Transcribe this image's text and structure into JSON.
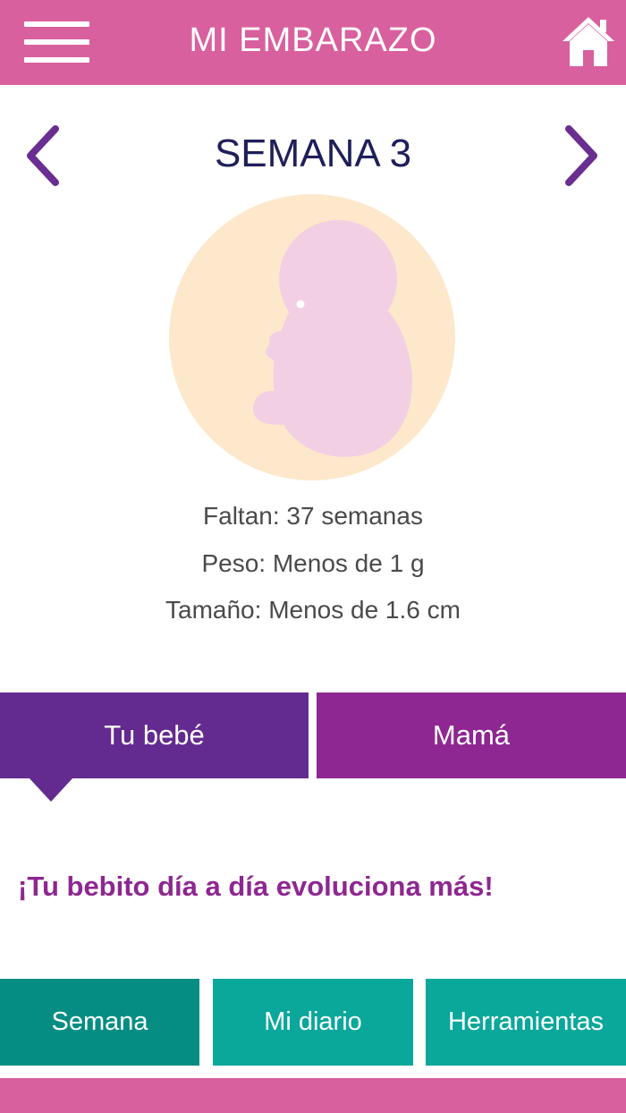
{
  "header": {
    "title": "MI EMBARAZO",
    "menu_icon": "hamburger-menu-icon",
    "home_icon": "home-icon",
    "background_color": "#d9609e"
  },
  "week": {
    "title": "SEMANA 3",
    "prev_icon": "chevron-left-icon",
    "next_icon": "chevron-right-icon",
    "arrow_color": "#6a2d91"
  },
  "illustration": {
    "icon": "fetus-illustration",
    "circle_color": "#fde8cc",
    "figure_color": "#f3cfe4"
  },
  "stats": {
    "remaining": "Faltan: 37 semanas",
    "weight": "Peso: Menos de 1 g",
    "size": "Tamaño: Menos de 1.6 cm"
  },
  "tabs": {
    "baby": "Tu bebé",
    "mom": "Mamá",
    "active": "baby"
  },
  "content": {
    "headline": "¡Tu bebito día a día evoluciona más!"
  },
  "bottom_nav": {
    "semana": "Semana",
    "diario": "Mi diario",
    "herramientas": "Herramientas",
    "active": "semana"
  },
  "colors": {
    "pink": "#d9609e",
    "purple_dark": "#632b90",
    "purple_magenta": "#8e2791",
    "teal_dark": "#058d84",
    "teal": "#0aa79b"
  }
}
